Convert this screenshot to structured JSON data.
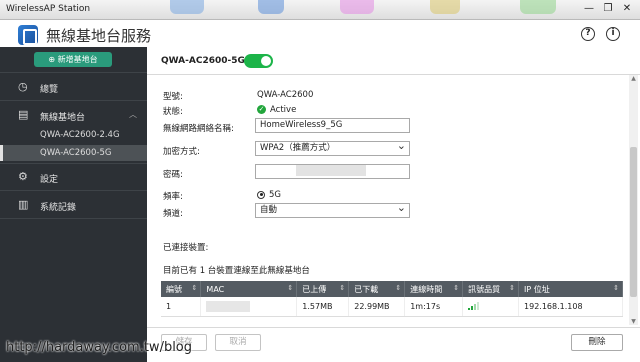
{
  "window": {
    "title": "WirelessAP Station",
    "minimize": "—",
    "maximize": "❐",
    "close": "✕"
  },
  "header": {
    "app_title": "無線基地台服務",
    "help_icon": "?",
    "info_icon": "i"
  },
  "sidebar": {
    "add_button": "新增基地台",
    "items": [
      {
        "label": "總覽",
        "icon": "clock-icon"
      },
      {
        "label": "無線基地台",
        "icon": "wifi-icon"
      },
      {
        "label": "設定",
        "icon": "gear-icon"
      },
      {
        "label": "系統記錄",
        "icon": "chart-icon"
      }
    ],
    "subitems": [
      {
        "label": "QWA-AC2600-2.4G",
        "active": false
      },
      {
        "label": "QWA-AC2600-5G",
        "active": true
      }
    ]
  },
  "main": {
    "ssid_title": "QWA-AC2600-5G",
    "enabled": true,
    "fields": {
      "model_label": "型號:",
      "model_value": "QWA-AC2600",
      "status_label": "狀態:",
      "status_value": "Active",
      "ssid_label": "無線網路網絡名稱:",
      "ssid_value": "HomeWireless9_5G",
      "security_label": "加密方式:",
      "security_value": "WPA2（推薦方式）",
      "password_label": "密碼:",
      "band_label": "頻率:",
      "band_value": "5G",
      "channel_label": "頻道:",
      "channel_value": "自動"
    },
    "connected_title": "已連接裝置:",
    "connected_summary": "目前已有 1 台裝置連線至此無線基地台",
    "table": {
      "headers": [
        "編號",
        "MAC",
        "已上傳",
        "已下載",
        "連線時間",
        "訊號品質",
        "IP 位址"
      ],
      "rows": [
        {
          "id": "1",
          "uploaded": "1.57MB",
          "downloaded": "22.99MB",
          "time": "1m:17s",
          "ip": "192.168.1.108"
        }
      ]
    },
    "buttons": {
      "apply": "儲存",
      "cancel": "取消",
      "delete": "刪除"
    }
  },
  "watermark": "http://hardaway.com.tw/blog",
  "colors": {
    "sidebar_bg": "#2c3035",
    "accent_green": "#1cb449",
    "add_button": "#2a9b7c",
    "table_header": "#545b62"
  }
}
